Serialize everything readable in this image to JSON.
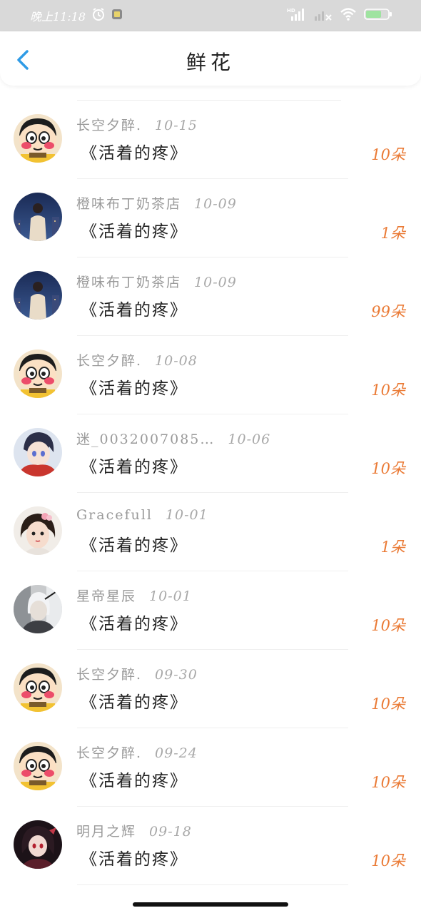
{
  "status_bar": {
    "time": "晚上11:18",
    "network": "HD",
    "battery_level": "66"
  },
  "header": {
    "title": "鲜花"
  },
  "records": [
    {
      "user": "长空夕醉.",
      "date": "10-15",
      "book": "《活着的疼》",
      "count": "10朵",
      "avatar": "shinchan-avatar"
    },
    {
      "user": "橙味布丁奶茶店",
      "date": "10-09",
      "book": "《活着的疼》",
      "count": "1朵",
      "avatar": "night-city-avatar"
    },
    {
      "user": "橙味布丁奶茶店",
      "date": "10-09",
      "book": "《活着的疼》",
      "count": "99朵",
      "avatar": "night-city-avatar"
    },
    {
      "user": "长空夕醉.",
      "date": "10-08",
      "book": "《活着的疼》",
      "count": "10朵",
      "avatar": "shinchan-avatar"
    },
    {
      "user": "迷_0032007085…",
      "date": "10-06",
      "book": "《活着的疼》",
      "count": "10朵",
      "avatar": "anime-boy-avatar"
    },
    {
      "user": "Gracefull",
      "date": "10-01",
      "book": "《活着的疼》",
      "count": "1朵",
      "avatar": "girl-avatar"
    },
    {
      "user": "星帝星辰",
      "date": "10-01",
      "book": "《活着的疼》",
      "count": "10朵",
      "avatar": "silver-hair-avatar"
    },
    {
      "user": "长空夕醉.",
      "date": "09-30",
      "book": "《活着的疼》",
      "count": "10朵",
      "avatar": "shinchan-avatar"
    },
    {
      "user": "长空夕醉.",
      "date": "09-24",
      "book": "《活着的疼》",
      "count": "10朵",
      "avatar": "shinchan-avatar"
    },
    {
      "user": "明月之辉",
      "date": "09-18",
      "book": "《活着的疼》",
      "count": "10朵",
      "avatar": "dark-anime-avatar"
    }
  ],
  "colors": {
    "accent_blue": "#2f9be6",
    "count_orange": "#ea7a35",
    "status_bar_bg": "#d9d9d9"
  }
}
